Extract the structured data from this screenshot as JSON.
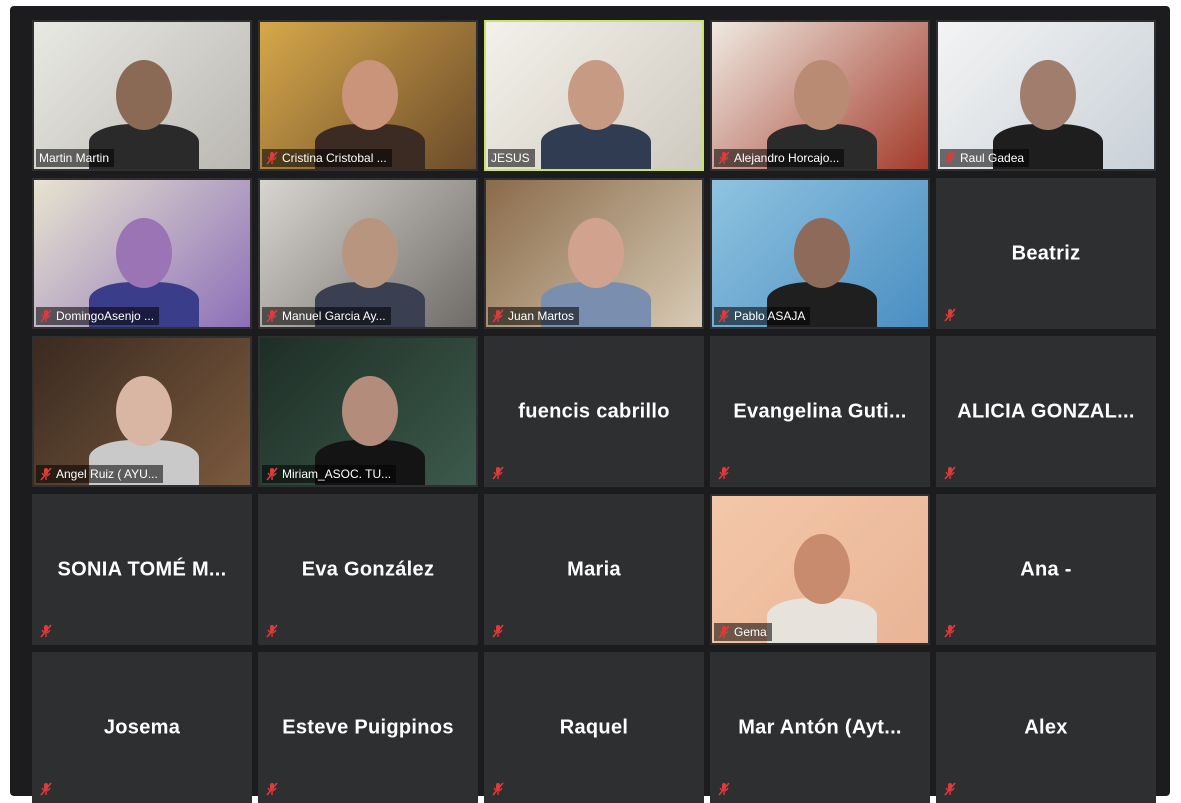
{
  "participants": [
    {
      "name": "Martin Martin",
      "video": true,
      "muted": false,
      "active": false,
      "scene": "room-white"
    },
    {
      "name": "Cristina Cristobal ...",
      "video": true,
      "muted": true,
      "active": false,
      "scene": "room-warm"
    },
    {
      "name": "JESUS",
      "video": true,
      "muted": false,
      "active": true,
      "scene": "room-light"
    },
    {
      "name": "Alejandro Horcajo...",
      "video": true,
      "muted": true,
      "active": false,
      "scene": "room-bright"
    },
    {
      "name": "Raul Gadea",
      "video": true,
      "muted": true,
      "active": false,
      "scene": "room-window"
    },
    {
      "name": "DomingoAsenjo ...",
      "video": true,
      "muted": true,
      "active": false,
      "scene": "room-purple"
    },
    {
      "name": "Manuel Garcia Ay...",
      "video": true,
      "muted": true,
      "active": false,
      "scene": "room-grey"
    },
    {
      "name": "Juan Martos",
      "video": true,
      "muted": true,
      "active": false,
      "scene": "room-shelves"
    },
    {
      "name": "Pablo ASAJA",
      "video": true,
      "muted": true,
      "active": false,
      "scene": "room-blue"
    },
    {
      "name": "Beatriz",
      "video": false,
      "muted": true,
      "active": false
    },
    {
      "name": "Angel Ruiz ( AYU...",
      "video": true,
      "muted": true,
      "active": false,
      "scene": "room-dark"
    },
    {
      "name": "Miriam_ASOC. TU...",
      "video": true,
      "muted": true,
      "active": false,
      "scene": "room-green"
    },
    {
      "name": "fuencis cabrillo",
      "video": false,
      "muted": true,
      "active": false
    },
    {
      "name": "Evangelina  Guti...",
      "video": false,
      "muted": true,
      "active": false
    },
    {
      "name": "ALICIA  GONZAL...",
      "video": false,
      "muted": true,
      "active": false
    },
    {
      "name": "SONIA  TOMÉ  M...",
      "video": false,
      "muted": true,
      "active": false
    },
    {
      "name": "Eva González",
      "video": false,
      "muted": true,
      "active": false
    },
    {
      "name": "Maria",
      "video": false,
      "muted": true,
      "active": false
    },
    {
      "name": "Gema",
      "video": true,
      "muted": true,
      "active": false,
      "scene": "room-peach"
    },
    {
      "name": "Ana -",
      "video": false,
      "muted": true,
      "active": false
    },
    {
      "name": "Josema",
      "video": false,
      "muted": true,
      "active": false
    },
    {
      "name": "Esteve Puigpinos",
      "video": false,
      "muted": true,
      "active": false
    },
    {
      "name": "Raquel",
      "video": false,
      "muted": true,
      "active": false
    },
    {
      "name": "Mar Antón (Ayt...",
      "video": false,
      "muted": true,
      "active": false
    },
    {
      "name": "Alex",
      "video": false,
      "muted": true,
      "active": false
    }
  ],
  "icons": {
    "muted": "mic-muted-icon"
  },
  "colors": {
    "muted_icon": "#e03a3a",
    "active_border": "#c7e36a",
    "tile_bg": "#2e2f31",
    "frame_bg": "#1c1c1e"
  }
}
